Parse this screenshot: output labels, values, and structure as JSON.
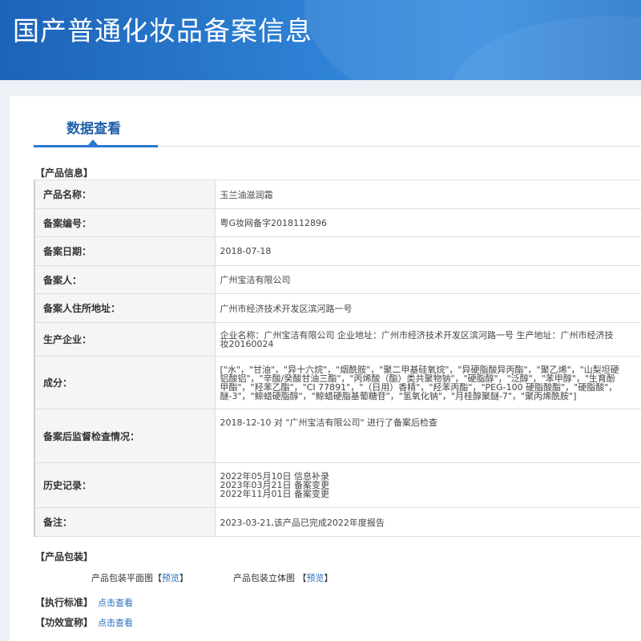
{
  "header": {
    "title": "国产普通化妆品备案信息"
  },
  "tab": {
    "label": "数据查看"
  },
  "sections": {
    "product_info": "【产品信息】",
    "packaging": "【产品包装】",
    "standard": "【执行标准】",
    "efficacy": "【功效宣称】"
  },
  "product": {
    "rows": [
      {
        "label": "产品名称：",
        "value": "玉兰油滋润霜"
      },
      {
        "label": "备案编号：",
        "value": "粤G妆网备字2018112896"
      },
      {
        "label": "备案日期：",
        "value": "2018-07-18"
      },
      {
        "label": "备案人：",
        "value": "广州宝洁有限公司"
      },
      {
        "label": "备案人住所地址：",
        "value": "广州市经济技术开发区滨河路一号"
      }
    ],
    "manufacturer": {
      "label": "生产企业：",
      "line1": "企业名称：广州宝洁有限公司 企业地址：广州市经济技术开发区滨河路一号 生产地址：广州市经济技",
      "line2": "妆20160024"
    },
    "ingredients": {
      "label": "成分：",
      "line1": "[\"水\"，\"甘油\"，\"异十六烷\"，\"烟酰胺\"，\"聚二甲基硅氧烷\"，\"异硬脂酸异丙酯\"，\"聚乙烯\"，\"山梨坦硬",
      "line2": "铝酸铝\"，\"辛酸/癸酸甘油三酯\"，\"丙烯酸（酯）类共聚物钠\"，\"硬脂醇\"，\"泛醇\"，\"苯甲醇\"，\"生育酚",
      "line3": "甲酯\"，\"羟苯乙酯\"，\"CI 77891\"，\"（日用）香精\"，\"羟苯丙酯\"，\"PEG-100 硬脂酸酯\"，\"硬脂酸\"，",
      "line4": "醚-3\"，\"鲸蜡硬脂醇\"，\"鲸蜡硬脂基葡糖苷\"，\"氢氧化钠\"，\"月桂醇聚醚-7\"，\"聚丙烯酰胺\"]"
    },
    "supervision": {
      "label": "备案后监督检查情况：",
      "value": "2018-12-10 对 \"广州宝洁有限公司\" 进行了备案后检查"
    },
    "history": {
      "label": "历史记录：",
      "items": [
        "2022年05月10日 信息补录",
        "2023年03月21日 备案变更",
        "2022年11月01日 备案变更"
      ]
    },
    "remark": {
      "label": "备注：",
      "value": "2023-03-21,该产品已完成2022年度报告"
    }
  },
  "packaging": {
    "flat_label": "产品包装平面图",
    "solid_label": "产品包装立体图",
    "preview_text": "预览",
    "bracket_open": "【",
    "bracket_close": "】"
  },
  "links": {
    "view": "点击查看"
  }
}
